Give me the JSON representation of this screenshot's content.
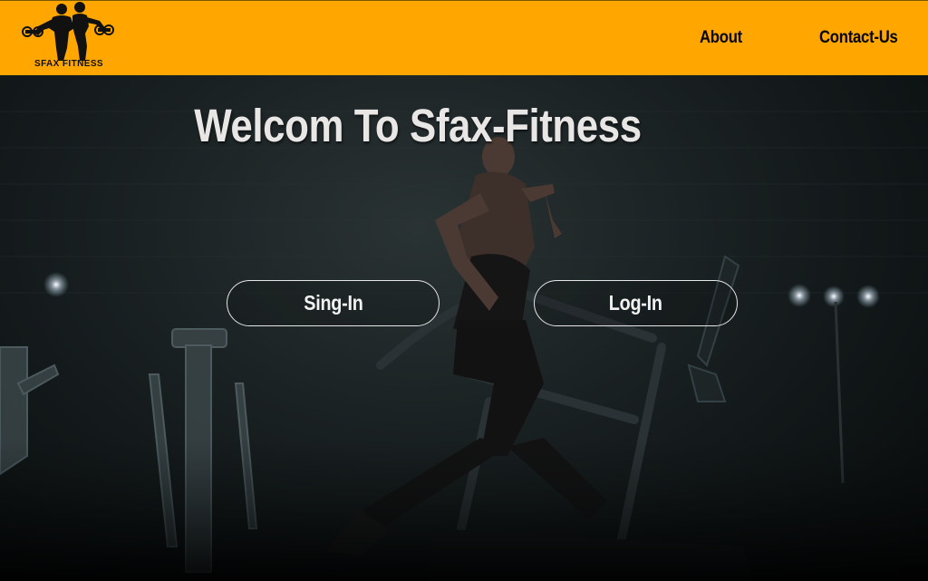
{
  "header": {
    "logo_text": "SFAX FITNESS",
    "logo_icon": "fitness-couple-dumbbells-logo",
    "nav": [
      {
        "label": "About"
      },
      {
        "label": "Contact-Us"
      }
    ],
    "background_color": "#ffa600"
  },
  "hero": {
    "title": "Welcom To Sfax-Fitness",
    "background_image": "woman-running-on-treadmill-in-dark-gym",
    "buttons": {
      "signin_label": "Sing-In",
      "login_label": "Log-In"
    }
  }
}
